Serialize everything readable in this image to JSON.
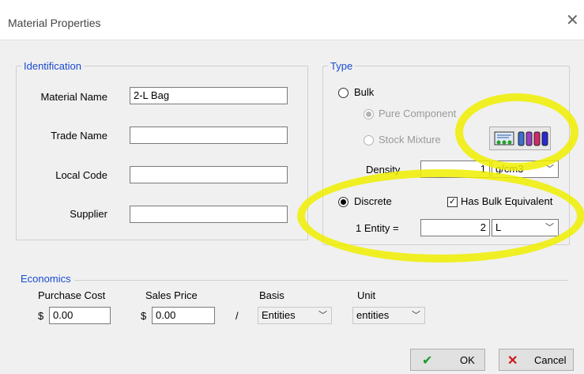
{
  "window": {
    "title": "Material Properties",
    "close_glyph": "✕"
  },
  "identification": {
    "legend": "Identification",
    "material_name_label": "Material Name",
    "material_name_value": "2-L Bag",
    "trade_name_label": "Trade Name",
    "trade_name_value": "",
    "local_code_label": "Local Code",
    "local_code_value": "",
    "supplier_label": "Supplier",
    "supplier_value": ""
  },
  "type": {
    "legend": "Type",
    "bulk_label": "Bulk",
    "pure_component_label": "Pure Component",
    "stock_mixture_label": "Stock Mixture",
    "density_label": "Density",
    "density_value": "1",
    "density_unit": "g/cm3",
    "discrete_label": "Discrete",
    "has_bulk_equiv_label": "Has Bulk Equivalent",
    "entity_label": "1 Entity =",
    "entity_value": "2",
    "entity_unit": "L"
  },
  "economics": {
    "legend": "Economics",
    "purchase_cost_label": "Purchase Cost",
    "purchase_cost_value": "0.00",
    "sales_price_label": "Sales Price",
    "sales_price_value": "0.00",
    "currency": "$",
    "separator": "/",
    "basis_label": "Basis",
    "basis_value": "Entities",
    "unit_label": "Unit",
    "unit_value": "entities"
  },
  "buttons": {
    "ok_label": "OK",
    "cancel_label": "Cancel",
    "ok_glyph": "✔",
    "cancel_glyph": "✕"
  },
  "colors": {
    "legend": "#1a4ad1",
    "highlight": "#eeee00",
    "ok_check": "#1a9a2a",
    "cancel_x": "#d01818"
  }
}
